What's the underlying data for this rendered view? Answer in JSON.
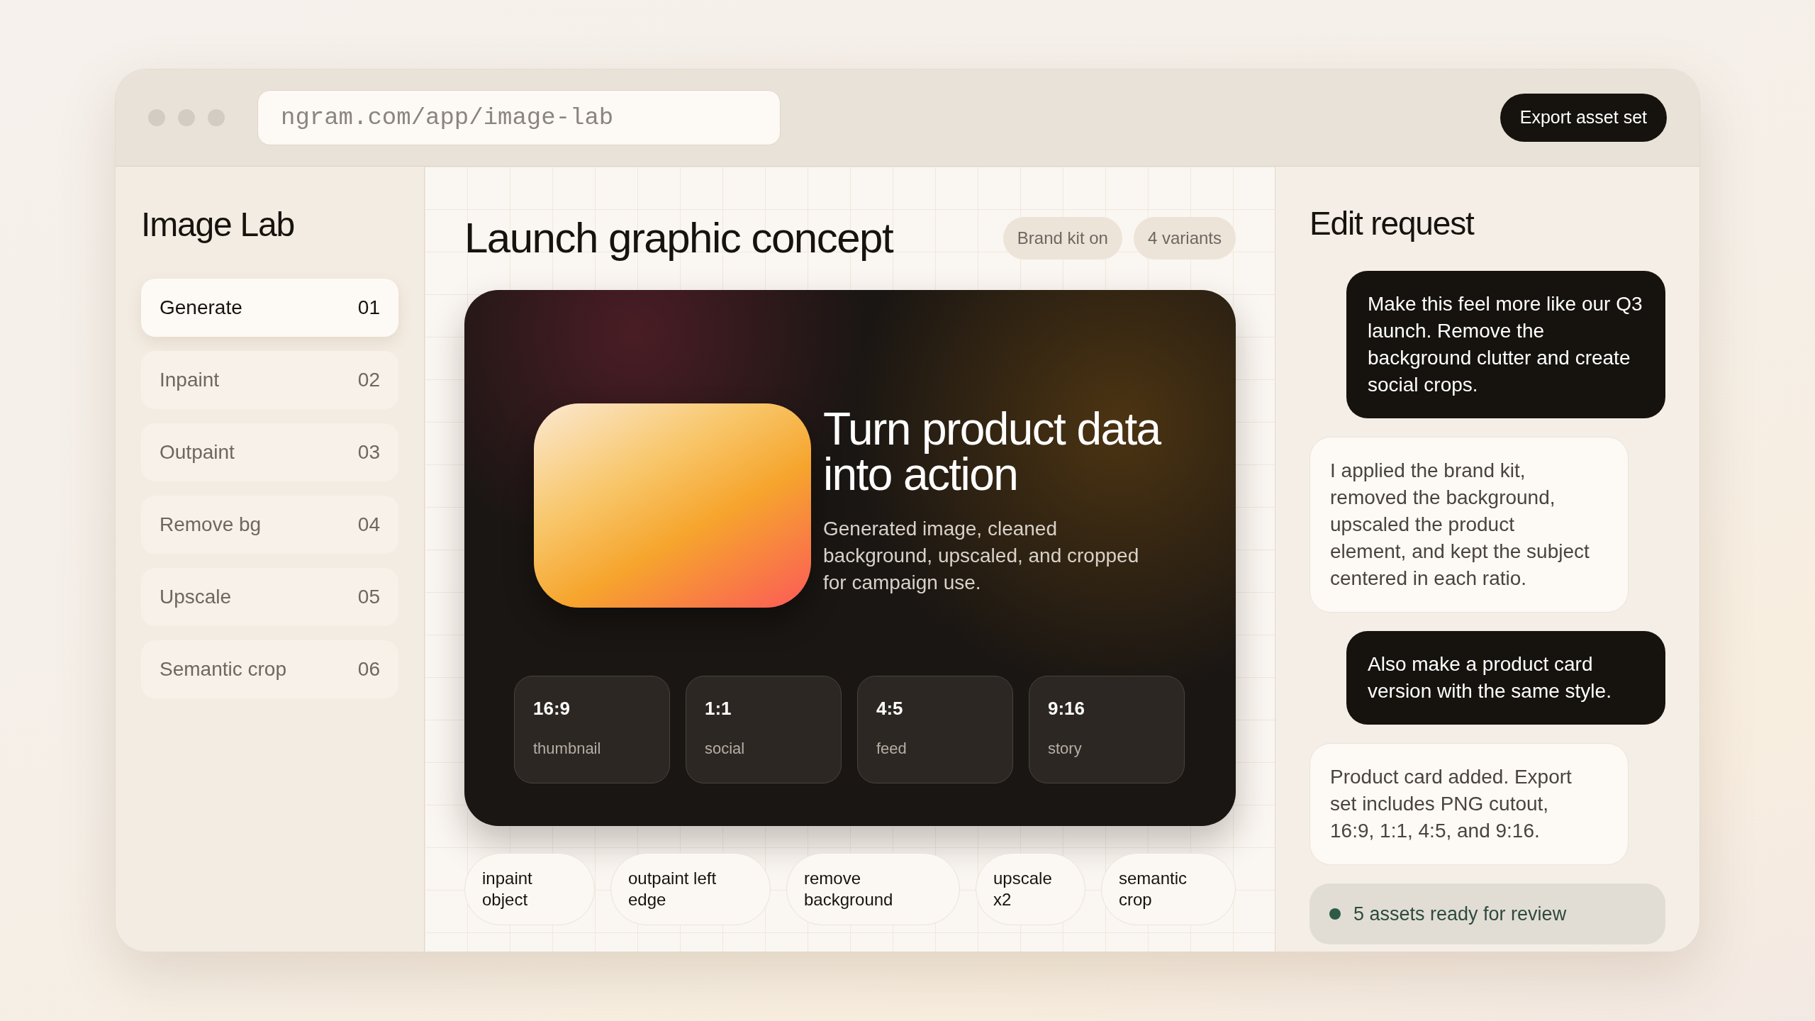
{
  "browser": {
    "url": "ngram.com/app/image-lab",
    "action": "Export asset set"
  },
  "sidebar": {
    "title": "Image Lab",
    "items": [
      {
        "label": "Generate",
        "number": "01",
        "selected": true
      },
      {
        "label": "Inpaint",
        "number": "02",
        "selected": false
      },
      {
        "label": "Outpaint",
        "number": "03",
        "selected": false
      },
      {
        "label": "Remove bg",
        "number": "04",
        "selected": false
      },
      {
        "label": "Upscale",
        "number": "05",
        "selected": false
      },
      {
        "label": "Semantic crop",
        "number": "06",
        "selected": false
      }
    ]
  },
  "main": {
    "title": "Launch graphic concept",
    "badges": [
      "Brand kit on",
      "4 variants"
    ],
    "preview": {
      "headline": "Turn product data into action",
      "body": "Generated image, cleaned background, upscaled, and cropped for campaign use.",
      "ratios": [
        {
          "ratio": "16:9",
          "use": "thumbnail"
        },
        {
          "ratio": "1:1",
          "use": "social"
        },
        {
          "ratio": "4:5",
          "use": "feed"
        },
        {
          "ratio": "9:16",
          "use": "story"
        }
      ]
    },
    "actions": [
      "inpaint object",
      "outpaint left edge",
      "remove background",
      "upscale x2",
      "semantic crop"
    ]
  },
  "chat": {
    "title": "Edit request",
    "messages": [
      {
        "kind": "user",
        "text": "Make this feel more like our Q3 launch. Remove the background clutter and create social crops."
      },
      {
        "kind": "assistant",
        "text": "I applied the brand kit, removed the background, upscaled the product element, and kept the subject centered in each ratio."
      },
      {
        "kind": "user",
        "text": "Also make a product card version with the same style."
      },
      {
        "kind": "assistant",
        "text": "Product card added. Export set includes PNG cutout, 16:9, 1:1, 4:5, and 9:16."
      }
    ],
    "status": "5 assets ready for review"
  }
}
